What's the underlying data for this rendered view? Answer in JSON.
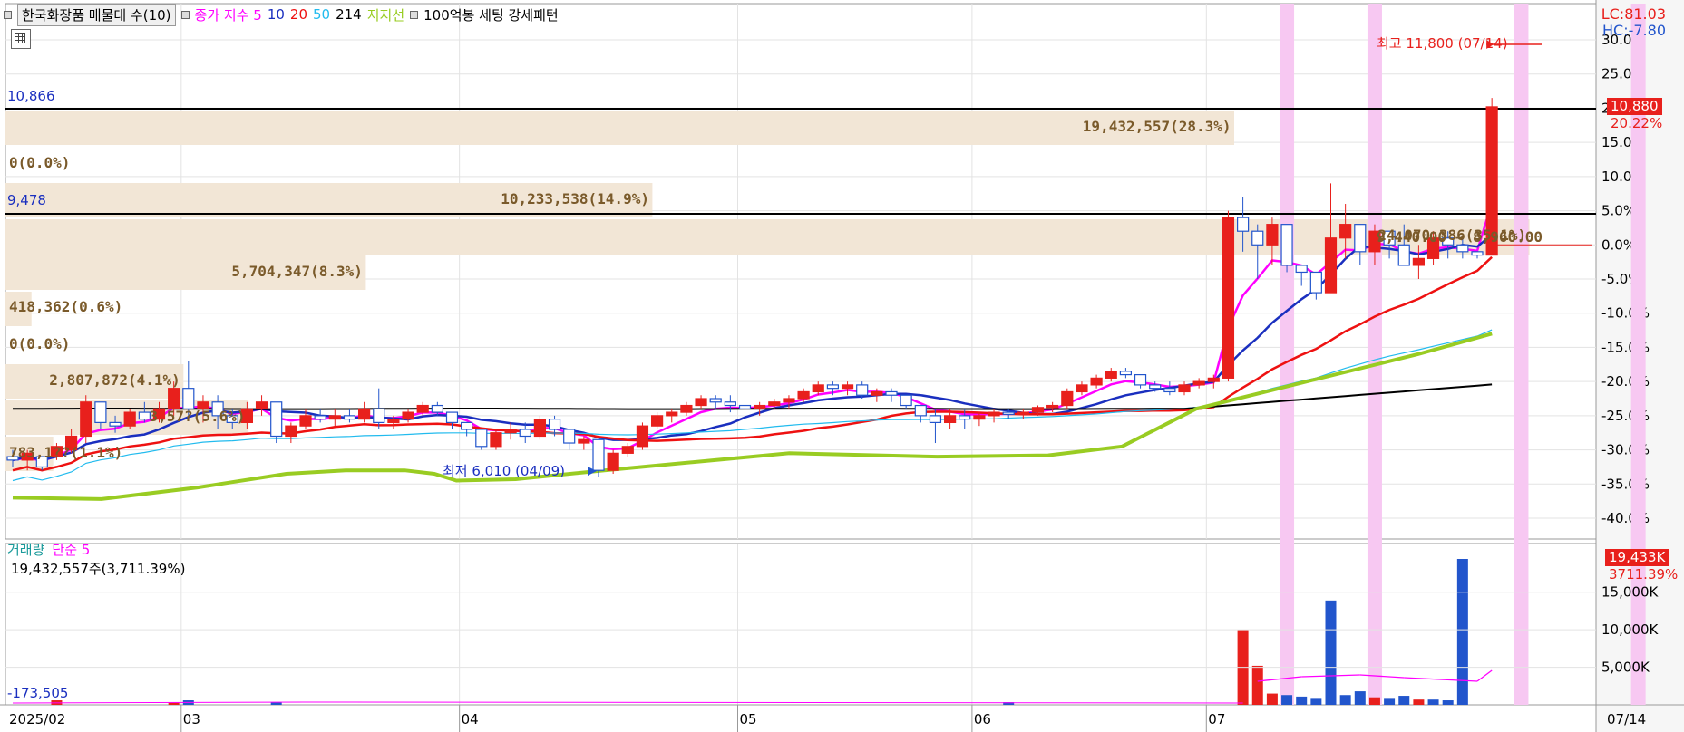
{
  "legend": {
    "title": "한국화장품 매물대 수(10)",
    "ma_title": "종가 지수 5",
    "ma_periods": [
      "10",
      "20",
      "50",
      "214"
    ],
    "support": "지지선",
    "setting": "100억봉 세팅 강세패턴",
    "colors": {
      "ma5": "#ff00ff",
      "ma10": "#1a2fbf",
      "ma20": "#ee1111",
      "ma50": "#22bbee",
      "ma214": "#000000",
      "support": "#99cc22",
      "up": "#e8201c",
      "down": "#2255cc"
    }
  },
  "top_right": {
    "lc": "LC:81.03",
    "hc": "HC:-7.80"
  },
  "price_tags": {
    "current": "10,880",
    "pct": "20.22%"
  },
  "annotations": {
    "high": "최고 11,800 (07/14)",
    "low": "최저 6,010 (04/09)",
    "level_high_value": "10,866",
    "level_low_value": "9,478"
  },
  "volume_profile": [
    {
      "label": "19,432,557(28.3%)",
      "fraction": 0.283
    },
    {
      "label": "0(0.0%)",
      "fraction": 0.0
    },
    {
      "label": "10,233,538(14.9%)",
      "fraction": 0.149
    },
    {
      "label": "24,070,386(35.1%)",
      "fraction": 0.351
    },
    {
      "label": "5,704,347(8.3%)",
      "fraction": 0.083
    },
    {
      "label": "418,362(0.6%)",
      "fraction": 0.006
    },
    {
      "label": "0(0.0%)",
      "fraction": 0.0
    },
    {
      "label": "2,807,872(4.1%)",
      "fraction": 0.041
    },
    {
      "label": "3,57?(5.6%)",
      "fraction": 0.056
    },
    {
      "label": "783,1??(1.1%)",
      "fraction": 0.011
    }
  ],
  "hover_values": "9,440.00 → 8,960.00",
  "volume_panel": {
    "title": "거래량",
    "ma_label": "단순 5",
    "current_text": "19,432,557주(3,711.39%)",
    "bottom_value": "-173,505",
    "tag_value": "19,433K",
    "tag_pct": "3711.39%",
    "axis_ticks": [
      "15,000K",
      "10,000K",
      "5,000K"
    ]
  },
  "x_axis": {
    "labels": [
      "2025/02",
      "03",
      "04",
      "05",
      "06",
      "07"
    ],
    "end_label": "07/14"
  },
  "chart_data": {
    "type": "candlestick",
    "y_axis_ticks_pct": [
      30,
      25,
      20,
      15,
      10,
      5,
      0,
      -5,
      -10,
      -15,
      -20,
      -25,
      -30,
      -35,
      -40
    ],
    "ylim_pct": [
      -42,
      31
    ],
    "base_price": 9050,
    "price_levels": [
      10866,
      9478
    ],
    "high": {
      "value": 11800,
      "date": "07/14"
    },
    "low": {
      "value": 6010,
      "date": "04/09"
    },
    "candles": [
      [
        -31,
        -30,
        -32.5,
        -31.5
      ],
      [
        -31.5,
        -30,
        -33,
        -30.5
      ],
      [
        -31,
        -31,
        -33,
        -32.5
      ],
      [
        -31,
        -29,
        -31.5,
        -29.5
      ],
      [
        -30,
        -27,
        -30.5,
        -28
      ],
      [
        -28,
        -22,
        -29,
        -23
      ],
      [
        -23,
        -24,
        -27,
        -26
      ],
      [
        -26,
        -25,
        -27.5,
        -26.5
      ],
      [
        -26.5,
        -24,
        -27,
        -24.5
      ],
      [
        -24.5,
        -23,
        -26,
        -25.5
      ],
      [
        -25.5,
        -23,
        -26,
        -24
      ],
      [
        -24,
        -20,
        -25,
        -21
      ],
      [
        -21,
        -17,
        -25,
        -24
      ],
      [
        -24,
        -22,
        -26,
        -23
      ],
      [
        -23,
        -22,
        -27,
        -25
      ],
      [
        -25,
        -24,
        -27,
        -26
      ],
      [
        -26,
        -23,
        -27,
        -24
      ],
      [
        -24,
        -22,
        -25,
        -23
      ],
      [
        -23,
        -25,
        -29,
        -28
      ],
      [
        -28,
        -26,
        -29,
        -26.5
      ],
      [
        -26.5,
        -24,
        -27,
        -25
      ],
      [
        -25,
        -24,
        -26,
        -25.5
      ],
      [
        -25.5,
        -24,
        -26.5,
        -25
      ],
      [
        -25,
        -24,
        -26,
        -25.5
      ],
      [
        -25.5,
        -23,
        -26,
        -24
      ],
      [
        -24,
        -21,
        -27,
        -26
      ],
      [
        -26,
        -25,
        -27,
        -25.5
      ],
      [
        -25.5,
        -24,
        -26,
        -24.5
      ],
      [
        -24.5,
        -23,
        -25,
        -23.5
      ],
      [
        -23.5,
        -23,
        -25,
        -24.5
      ],
      [
        -24.5,
        -25,
        -27,
        -26
      ],
      [
        -26,
        -26,
        -28,
        -27
      ],
      [
        -27,
        -27,
        -30,
        -29.5
      ],
      [
        -29.5,
        -27,
        -30,
        -27.5
      ],
      [
        -27.5,
        -26,
        -28.5,
        -27
      ],
      [
        -27,
        -26,
        -29,
        -28
      ],
      [
        -28,
        -25,
        -28.5,
        -25.5
      ],
      [
        -25.5,
        -25,
        -28,
        -27
      ],
      [
        -27,
        -27,
        -30,
        -29
      ],
      [
        -29,
        -28,
        -30,
        -28.5
      ],
      [
        -28.5,
        -29,
        -34,
        -33
      ],
      [
        -33,
        -30,
        -33.5,
        -30.5
      ],
      [
        -30.5,
        -29,
        -31,
        -29.5
      ],
      [
        -29.5,
        -26,
        -30,
        -26.5
      ],
      [
        -26.5,
        -24.5,
        -27,
        -25
      ],
      [
        -25,
        -24,
        -26,
        -24.5
      ],
      [
        -24.5,
        -23,
        -25,
        -23.5
      ],
      [
        -23.5,
        -22,
        -24,
        -22.5
      ],
      [
        -22.5,
        -22,
        -24,
        -23
      ],
      [
        -23,
        -22,
        -24.5,
        -23.5
      ],
      [
        -23.5,
        -23,
        -25,
        -24
      ],
      [
        -24,
        -23,
        -25,
        -23.5
      ],
      [
        -23.5,
        -22.5,
        -24,
        -23
      ],
      [
        -23,
        -22,
        -24,
        -22.5
      ],
      [
        -22.5,
        -21,
        -23,
        -21.5
      ],
      [
        -21.5,
        -20,
        -22,
        -20.5
      ],
      [
        -20.5,
        -20,
        -22,
        -21
      ],
      [
        -21,
        -20,
        -22,
        -20.5
      ],
      [
        -20.5,
        -20,
        -22.5,
        -22
      ],
      [
        -22,
        -21,
        -23,
        -21.5
      ],
      [
        -21.5,
        -21,
        -23,
        -22
      ],
      [
        -22,
        -22,
        -24,
        -23.5
      ],
      [
        -23.5,
        -24,
        -26,
        -25
      ],
      [
        -25,
        -24,
        -29,
        -26
      ],
      [
        -26,
        -24,
        -27,
        -25
      ],
      [
        -25,
        -24,
        -27,
        -25.5
      ],
      [
        -25.5,
        -24.5,
        -26.5,
        -25
      ],
      [
        -25,
        -24,
        -26,
        -24.5
      ],
      [
        -24.5,
        -24,
        -25.5,
        -24.8
      ],
      [
        -24.8,
        -24,
        -25.5,
        -24.5
      ],
      [
        -24.5,
        -23.5,
        -25,
        -23.8
      ],
      [
        -23.8,
        -23,
        -24.5,
        -23.5
      ],
      [
        -23.5,
        -21,
        -24,
        -21.5
      ],
      [
        -21.5,
        -20,
        -22,
        -20.5
      ],
      [
        -20.5,
        -19,
        -21,
        -19.5
      ],
      [
        -19.5,
        -18,
        -20,
        -18.5
      ],
      [
        -18.5,
        -18,
        -19.5,
        -19
      ],
      [
        -19,
        -19,
        -21,
        -20.5
      ],
      [
        -20.5,
        -20,
        -21.5,
        -21
      ],
      [
        -21,
        -20,
        -22,
        -21.5
      ],
      [
        -21.5,
        -20,
        -22,
        -20.5
      ],
      [
        -20.5,
        -19.5,
        -21,
        -20
      ],
      [
        -20,
        -19,
        -21,
        -19.5
      ],
      [
        -19.5,
        5,
        -20,
        4
      ],
      [
        4,
        7,
        -1,
        2
      ],
      [
        2,
        3,
        -5,
        0
      ],
      [
        0,
        4,
        -3,
        3
      ],
      [
        3,
        3,
        -4,
        -3
      ],
      [
        -3,
        -3,
        -6,
        -4
      ],
      [
        -4,
        -6,
        -8,
        -7
      ],
      [
        -7,
        9,
        -7,
        1
      ],
      [
        1,
        6,
        -2,
        3
      ],
      [
        3,
        2,
        -3,
        -1
      ],
      [
        -1,
        3,
        -3,
        2
      ],
      [
        2,
        2,
        -2,
        0
      ],
      [
        0,
        3,
        -3,
        -3
      ],
      [
        -3,
        0,
        -5,
        -2
      ],
      [
        -2,
        2,
        -3,
        1
      ],
      [
        1,
        2,
        -2,
        0
      ],
      [
        0,
        1,
        -2,
        -1
      ],
      [
        -1,
        -1,
        -2,
        -1.5
      ],
      [
        -1.5,
        21.5,
        -1.5,
        20.2
      ]
    ],
    "support_line_pct": [
      [
        0,
        -37
      ],
      [
        12,
        -37.2
      ],
      [
        25,
        -35.5
      ],
      [
        37,
        -33.5
      ],
      [
        45,
        -33
      ],
      [
        53,
        -33
      ],
      [
        57,
        -33.5
      ],
      [
        60,
        -34.5
      ],
      [
        68,
        -34.3
      ],
      [
        80,
        -33
      ],
      [
        95,
        -31.5
      ],
      [
        105,
        -30.5
      ],
      [
        125,
        -31
      ],
      [
        140,
        -30.8
      ],
      [
        150,
        -29.5
      ],
      [
        160,
        -24
      ],
      [
        175,
        -20
      ],
      [
        190,
        -16
      ],
      [
        200,
        -13
      ]
    ],
    "volume_k": [
      0,
      0,
      0,
      600,
      0,
      0,
      0,
      0,
      0,
      0,
      0,
      300,
      600,
      0,
      0,
      0,
      0,
      0,
      200,
      0,
      0,
      0,
      0,
      0,
      0,
      0,
      0,
      0,
      0,
      0,
      0,
      0,
      0,
      0,
      0,
      0,
      0,
      0,
      0,
      0,
      0,
      0,
      0,
      0,
      0,
      0,
      0,
      0,
      0,
      0,
      0,
      0,
      0,
      0,
      0,
      0,
      0,
      0,
      0,
      0,
      0,
      0,
      0,
      0,
      0,
      0,
      0,
      0,
      300,
      0,
      0,
      0,
      0,
      0,
      0,
      0,
      0,
      0,
      0,
      0,
      0,
      0,
      0,
      0,
      10000,
      5200,
      1500,
      1300,
      1100,
      800,
      13900,
      1300,
      1800,
      1000,
      800,
      1200,
      700,
      700,
      600,
      19433
    ]
  }
}
